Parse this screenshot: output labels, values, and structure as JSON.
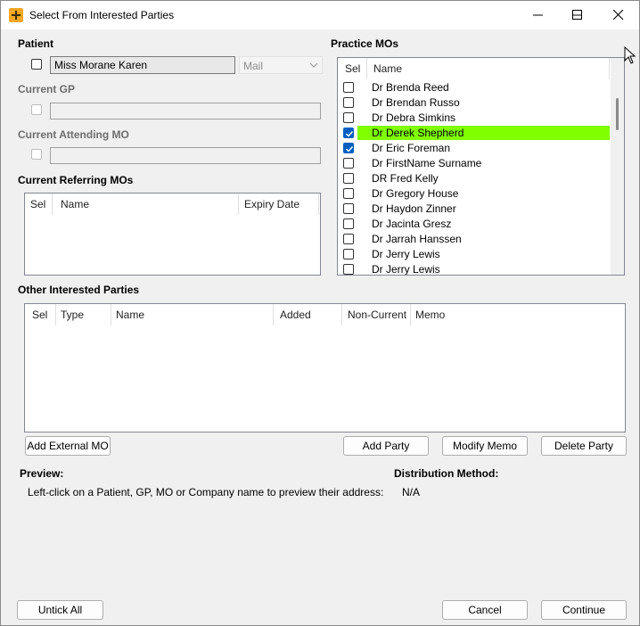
{
  "window": {
    "title": "Select From Interested Parties",
    "minimize_label": "",
    "icon": "app-plus-icon"
  },
  "patient": {
    "label": "Patient",
    "name": "Miss Morane Karen",
    "delivery_method": "Mail"
  },
  "current_gp": {
    "label": "Current GP",
    "value": ""
  },
  "current_attending_mo": {
    "label": "Current Attending MO",
    "value": ""
  },
  "current_referring_mos": {
    "label": "Current Referring MOs",
    "columns": [
      "Sel",
      "Name",
      "Expiry Date"
    ],
    "rows": []
  },
  "practice_mos": {
    "label": "Practice MOs",
    "columns": [
      "Sel",
      "Name"
    ],
    "rows": [
      {
        "name": "Dr Brenda Reed",
        "checked": false,
        "highlighted": false
      },
      {
        "name": "Dr Brendan Russo",
        "checked": false,
        "highlighted": false
      },
      {
        "name": "Dr Debra Simkins",
        "checked": false,
        "highlighted": false
      },
      {
        "name": "Dr Derek Shepherd",
        "checked": true,
        "highlighted": true
      },
      {
        "name": "Dr Eric Foreman",
        "checked": true,
        "highlighted": false
      },
      {
        "name": "Dr FirstName Surname",
        "checked": false,
        "highlighted": false
      },
      {
        "name": "DR Fred Kelly",
        "checked": false,
        "highlighted": false
      },
      {
        "name": "Dr Gregory House",
        "checked": false,
        "highlighted": false
      },
      {
        "name": "Dr Haydon Zinner",
        "checked": false,
        "highlighted": false
      },
      {
        "name": "Dr Jacinta Gresz",
        "checked": false,
        "highlighted": false
      },
      {
        "name": "Dr Jarrah Hanssen",
        "checked": false,
        "highlighted": false
      },
      {
        "name": "Dr Jerry Lewis",
        "checked": false,
        "highlighted": false
      },
      {
        "name": "Dr Jerry Lewis",
        "checked": false,
        "highlighted": false
      }
    ],
    "highlight_color": "#80ff00"
  },
  "other_interested_parties": {
    "label": "Other Interested Parties",
    "columns": [
      "Sel",
      "Type",
      "Name",
      "Added",
      "Non-Current",
      "Memo"
    ],
    "rows": []
  },
  "buttons": {
    "add_external_mo": "Add External MO",
    "add_party": "Add Party",
    "modify_memo": "Modify Memo",
    "delete_party": "Delete Party",
    "untick_all": "Untick All",
    "cancel": "Cancel",
    "continue": "Continue"
  },
  "preview": {
    "label": "Preview:",
    "text": "Left-click on a Patient, GP, MO or Company name to preview their address:"
  },
  "distribution": {
    "label": "Distribution Method:",
    "value": "N/A"
  },
  "colors": {
    "checkbox_checked": "#0060c0",
    "window_bg": "#f0f0f0"
  }
}
